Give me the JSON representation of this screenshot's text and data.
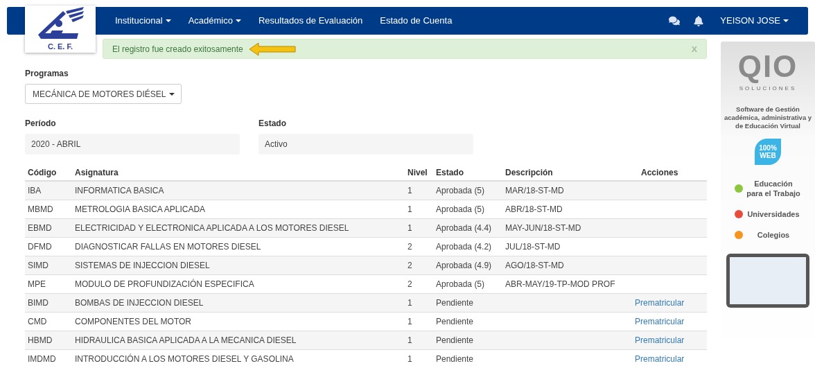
{
  "logo": {
    "text": "C. E. F."
  },
  "nav": {
    "items": [
      {
        "label": "Institucional",
        "dropdown": true
      },
      {
        "label": "Académico",
        "dropdown": true
      },
      {
        "label": "Resultados de Evaluación",
        "dropdown": false
      },
      {
        "label": "Estado de Cuenta",
        "dropdown": false
      }
    ],
    "user": "YEISON JOSE"
  },
  "alert": {
    "message": "El registro fue creado exitosamente",
    "close": "x"
  },
  "program": {
    "label": "Programas",
    "value": "MECÁNICA DE MOTORES DIÉSEL"
  },
  "period": {
    "label": "Período",
    "value": "2020 - ABRIL"
  },
  "status": {
    "label": "Estado",
    "value": "Activo"
  },
  "table": {
    "columns": [
      "Código",
      "Asignatura",
      "Nivel",
      "Estado",
      "Descripción",
      "Acciones"
    ],
    "rows": [
      {
        "code": "IBA",
        "subject": "INFORMATICA BASICA",
        "level_text": "1",
        "state": "Aprobada (5)",
        "description": "MAR/18-ST-MD"
      },
      {
        "code": "MBMD",
        "subject": "METROLOGIA BASICA APLICADA",
        "level_text": "1",
        "state": "Aprobada (5)",
        "description": "ABR/18-ST-MD"
      },
      {
        "code": "EBMD",
        "subject": "ELECTRICIDAD Y ELECTRONICA APLICADA A LOS MOTORES DIESEL",
        "level_text": "1",
        "state": "Aprobada (4.4)",
        "description": "MAY-JUN/18-ST-MD"
      },
      {
        "code": "DFMD",
        "subject": "DIAGNOSTICAR FALLAS EN MOTORES DIESEL",
        "level_text": "2",
        "state": "Aprobada (4.2)",
        "description": "JUL/18-ST-MD"
      },
      {
        "code": "SIMD",
        "subject": "SISTEMAS DE INJECCION DIESEL",
        "level_text": "2",
        "state": "Aprobada (4.9)",
        "description": "AGO/18-ST-MD"
      },
      {
        "code": "MPE",
        "subject": "MODULO DE PROFUNDIZACIÓN ESPECIFICA",
        "level_text": "2",
        "state": "Aprobada (5)",
        "description": "ABR-MAY/19-TP-MOD PROF"
      },
      {
        "code": "BIMD",
        "subject": "BOMBAS DE INJECCION DIESEL",
        "level_text": "1",
        "state": "Pendiente",
        "action": "Prematricular"
      },
      {
        "code": "CMD",
        "subject": "COMPONENTES DEL MOTOR",
        "level_text": "1",
        "state": "Pendiente",
        "action": "Prematricular"
      },
      {
        "code": "HBMD",
        "subject": "HIDRAULICA BASICA APLICADA A LA MECANICA DIESEL",
        "level_text": "1",
        "state": "Pendiente",
        "action": "Prematricular"
      },
      {
        "code": "IMDMD",
        "subject": "INTRODUCCIÓN A LOS MOTORES DIESEL Y GASOLINA",
        "level_text": "1",
        "state": "Pendiente",
        "action": "Prematricular"
      }
    ]
  },
  "ad": {
    "brand": "QIO",
    "tagline": "SOLUCIONES",
    "headline": "Software de Gestión académica, administrativa y de Educación Virtual",
    "badge": "100% WEB",
    "segments": [
      "Educación para el Trabajo",
      "Universidades",
      "Colegios"
    ]
  }
}
